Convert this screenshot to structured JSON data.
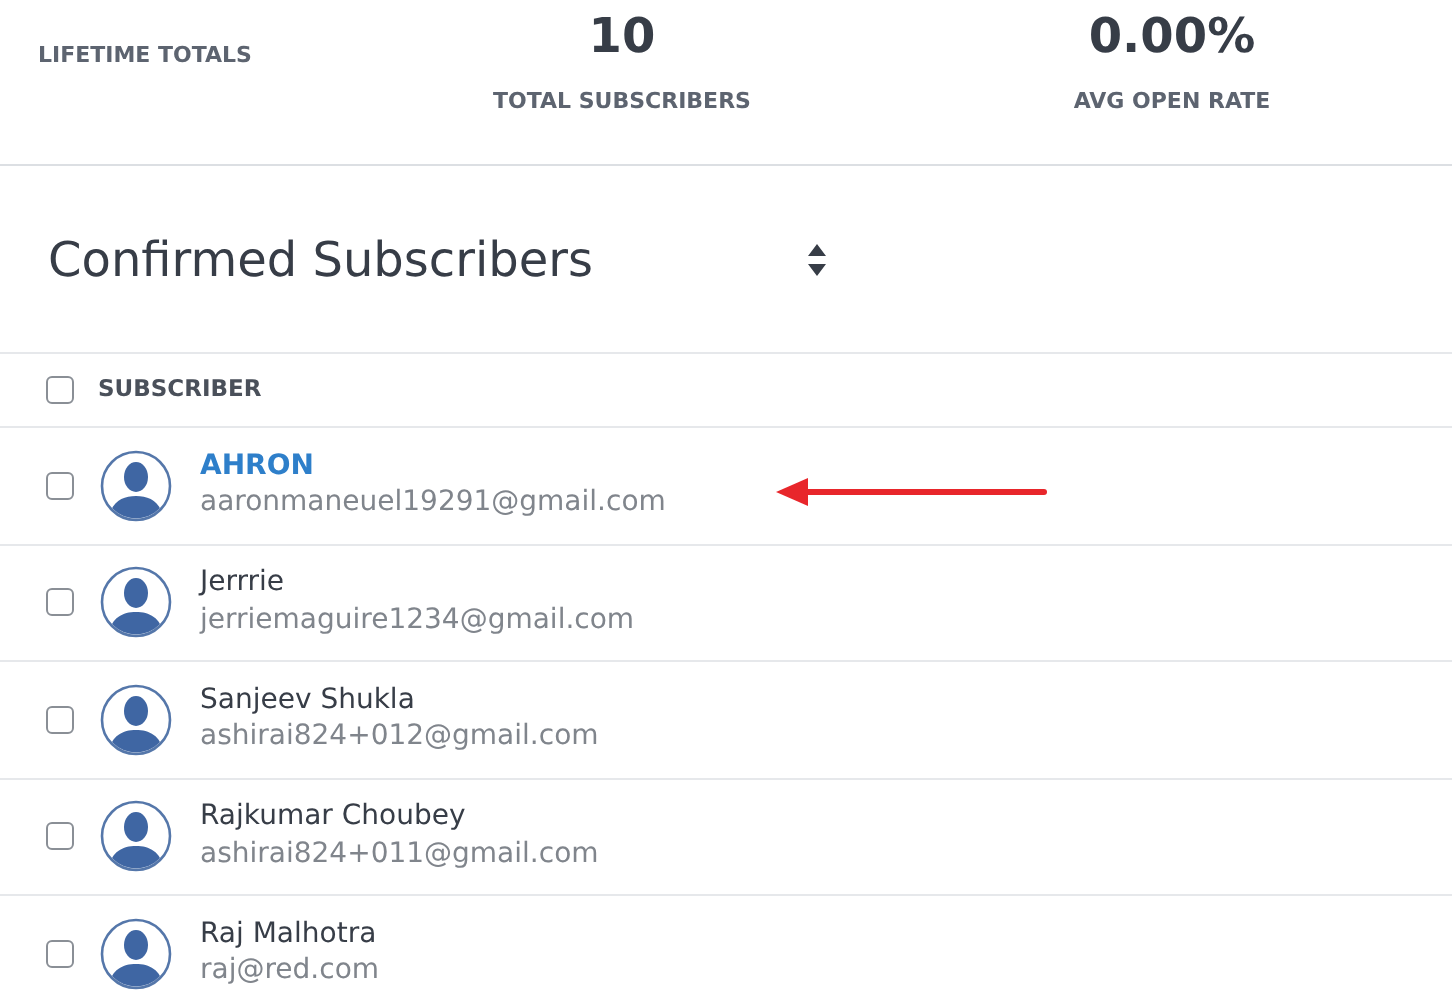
{
  "totals": {
    "label": "LIFETIME TOTALS",
    "stats": [
      {
        "value": "10",
        "label": "TOTAL SUBSCRIBERS"
      },
      {
        "value": "0.00%",
        "label": "AVG OPEN RATE"
      }
    ]
  },
  "list_select": {
    "value": "Confirmed Subscribers"
  },
  "table": {
    "header": {
      "checked": false,
      "label": "SUBSCRIBER"
    },
    "rows": [
      {
        "checked": false,
        "hovered": true,
        "name": "AHRON",
        "email": "aaronmaneuel19291@gmail.com"
      },
      {
        "checked": false,
        "hovered": false,
        "name": "Jerrrie",
        "email": "jerriemaguire1234@gmail.com"
      },
      {
        "checked": false,
        "hovered": false,
        "name": "Sanjeev Shukla",
        "email": "ashirai824+012@gmail.com"
      },
      {
        "checked": false,
        "hovered": false,
        "name": "Rajkumar Choubey",
        "email": "ashirai824+011@gmail.com"
      },
      {
        "checked": false,
        "hovered": false,
        "name": "Raj Malhotra",
        "email": "raj@red.com"
      }
    ]
  }
}
